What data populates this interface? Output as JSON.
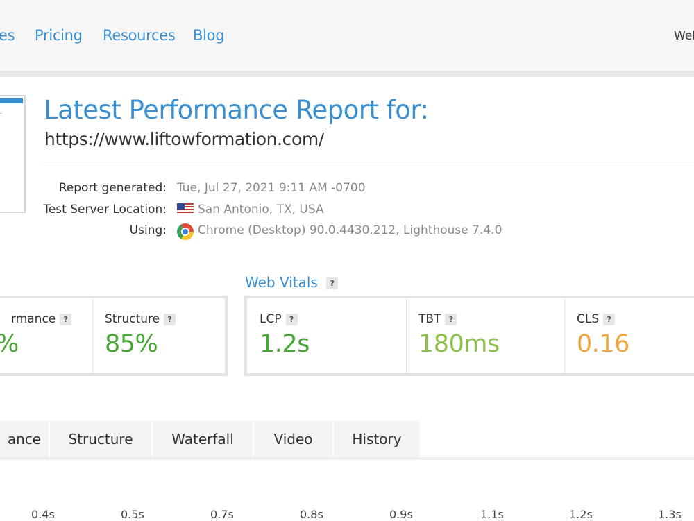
{
  "nav": {
    "items": [
      {
        "label": "es"
      },
      {
        "label": "Pricing"
      },
      {
        "label": "Resources"
      },
      {
        "label": "Blog"
      }
    ],
    "welcome": "Wel"
  },
  "report": {
    "title": "Latest Performance Report for:",
    "url": "https://www.liftowformation.com/",
    "meta": {
      "generated_label": "Report generated:",
      "generated_value": "Tue, Jul 27, 2021 9:11 AM -0700",
      "location_label": "Test Server Location:",
      "location_value": "San Antonio, TX, USA",
      "location_icon": "us-flag-icon",
      "using_label": "Using:",
      "using_value": "Chrome (Desktop) 90.0.4430.212, Lighthouse 7.4.0",
      "using_icon": "chrome-icon"
    }
  },
  "scores": {
    "performance_label": "rmance",
    "performance_value": "%",
    "structure_label": "Structure",
    "structure_value": "85%",
    "help": "?"
  },
  "web_vitals": {
    "heading": "Web Vitals",
    "help": "?",
    "lcp_label": "LCP",
    "lcp_value": "1.2s",
    "tbt_label": "TBT",
    "tbt_value": "180ms",
    "cls_label": "CLS",
    "cls_value": "0.16"
  },
  "colors": {
    "accent": "#3a8fd0",
    "good_green": "#44a832",
    "ok_green": "#8cc04a",
    "warn_orange": "#f2a33a"
  },
  "tabs": [
    {
      "label": "ance"
    },
    {
      "label": "Structure"
    },
    {
      "label": "Waterfall"
    },
    {
      "label": "Video"
    },
    {
      "label": "History"
    }
  ],
  "timeline": {
    "ticks": [
      "0.4s",
      "0.5s",
      "0.7s",
      "0.8s",
      "0.9s",
      "1.1s",
      "1.2s",
      "1.3s"
    ]
  }
}
